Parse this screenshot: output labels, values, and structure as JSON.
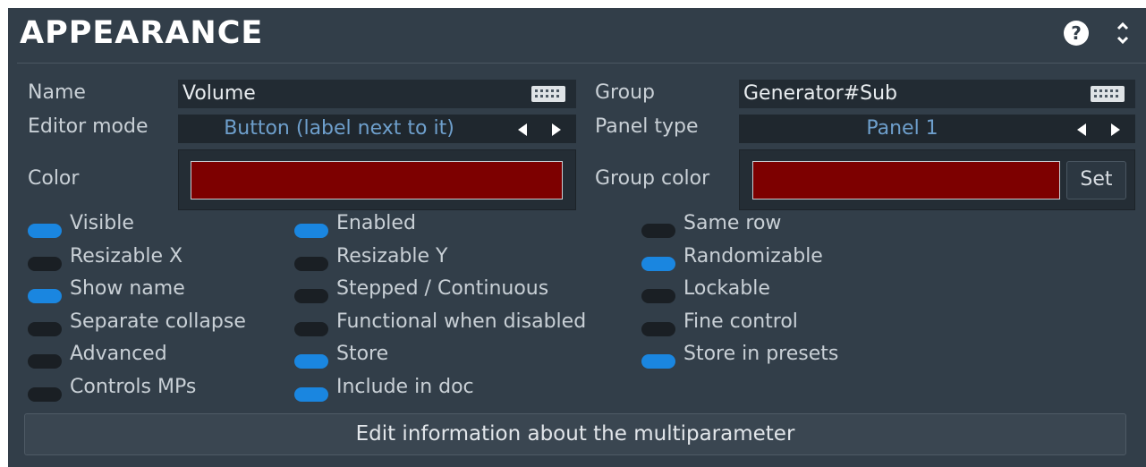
{
  "section": {
    "title": "APPEARANCE",
    "help_glyph": "?",
    "help_icon": "help-icon",
    "collapse_icon": "chevron-up-down-icon"
  },
  "fields": {
    "name_label": "Name",
    "name_value": "Volume",
    "group_label": "Group",
    "group_value": "Generator#Sub",
    "editor_mode_label": "Editor mode",
    "editor_mode_value": "Button (label next to it)",
    "panel_type_label": "Panel type",
    "panel_type_value": "Panel 1",
    "color_label": "Color",
    "color_value": "#7d0000",
    "group_color_label": "Group color",
    "group_color_value": "#7d0000",
    "set_label": "Set"
  },
  "options": [
    {
      "label": "Visible",
      "on": true
    },
    {
      "label": "Enabled",
      "on": true
    },
    {
      "label": "Same row",
      "on": false
    },
    {
      "label": "Resizable X",
      "on": false
    },
    {
      "label": "Resizable Y",
      "on": false
    },
    {
      "label": "Randomizable",
      "on": true
    },
    {
      "label": "Show name",
      "on": true
    },
    {
      "label": "Stepped / Continuous",
      "on": false
    },
    {
      "label": "Lockable",
      "on": false
    },
    {
      "label": "Separate collapse",
      "on": false
    },
    {
      "label": "Functional when disabled",
      "on": false
    },
    {
      "label": "Fine control",
      "on": false
    },
    {
      "label": "Advanced",
      "on": false
    },
    {
      "label": "Store",
      "on": true
    },
    {
      "label": "Store in presets",
      "on": true
    },
    {
      "label": "Controls MPs",
      "on": false
    },
    {
      "label": "Include in doc",
      "on": true
    }
  ],
  "edit_button_label": "Edit information about the multiparameter",
  "colors": {
    "panel_bg": "#323e49",
    "toggle_on": "#1a86e0",
    "toggle_off": "#1a1f24",
    "selector_text": "#6e9fcc"
  }
}
